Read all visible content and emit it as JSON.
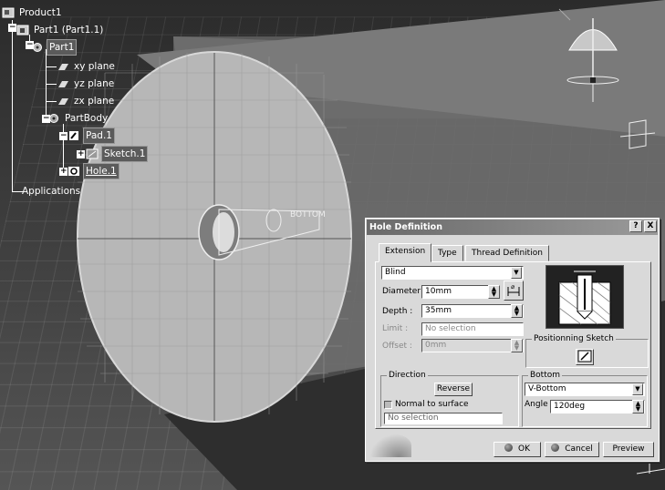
{
  "tree": {
    "product": "Product1",
    "part_instance": "Part1 (Part1.1)",
    "part": "Part1",
    "xy_plane": "xy plane",
    "yz_plane": "yz plane",
    "zx_plane": "zx plane",
    "part_body": "PartBody",
    "pad": "Pad.1",
    "sketch": "Sketch.1",
    "hole": "Hole.1",
    "applications": "Applications"
  },
  "scene": {
    "bottom_label": "BOTTOM"
  },
  "dialog": {
    "title": "Hole Definition",
    "help_button": "?",
    "close_button": "X",
    "tabs": [
      "Extension",
      "Type",
      "Thread Definition"
    ],
    "active_tab": "Extension",
    "extension_type": "Blind",
    "diameter_label": "Diameter :",
    "diameter_value": "10mm",
    "depth_label": "Depth :",
    "depth_value": "35mm",
    "limit_label": "Limit :",
    "limit_value": "No selection",
    "offset_label": "Offset :",
    "offset_value": "0mm",
    "positioning_sketch_label": "Positionning Sketch",
    "direction": {
      "title": "Direction",
      "reverse_button": "Reverse",
      "normal_to_surface_label": "Normal to surface",
      "normal_to_surface_checked": true,
      "selection_value": "No selection"
    },
    "bottom": {
      "title": "Bottom",
      "type_value": "V-Bottom",
      "angle_label": "Angle :",
      "angle_value": "120deg"
    },
    "buttons": {
      "ok": "OK",
      "cancel": "Cancel",
      "preview": "Preview"
    }
  }
}
